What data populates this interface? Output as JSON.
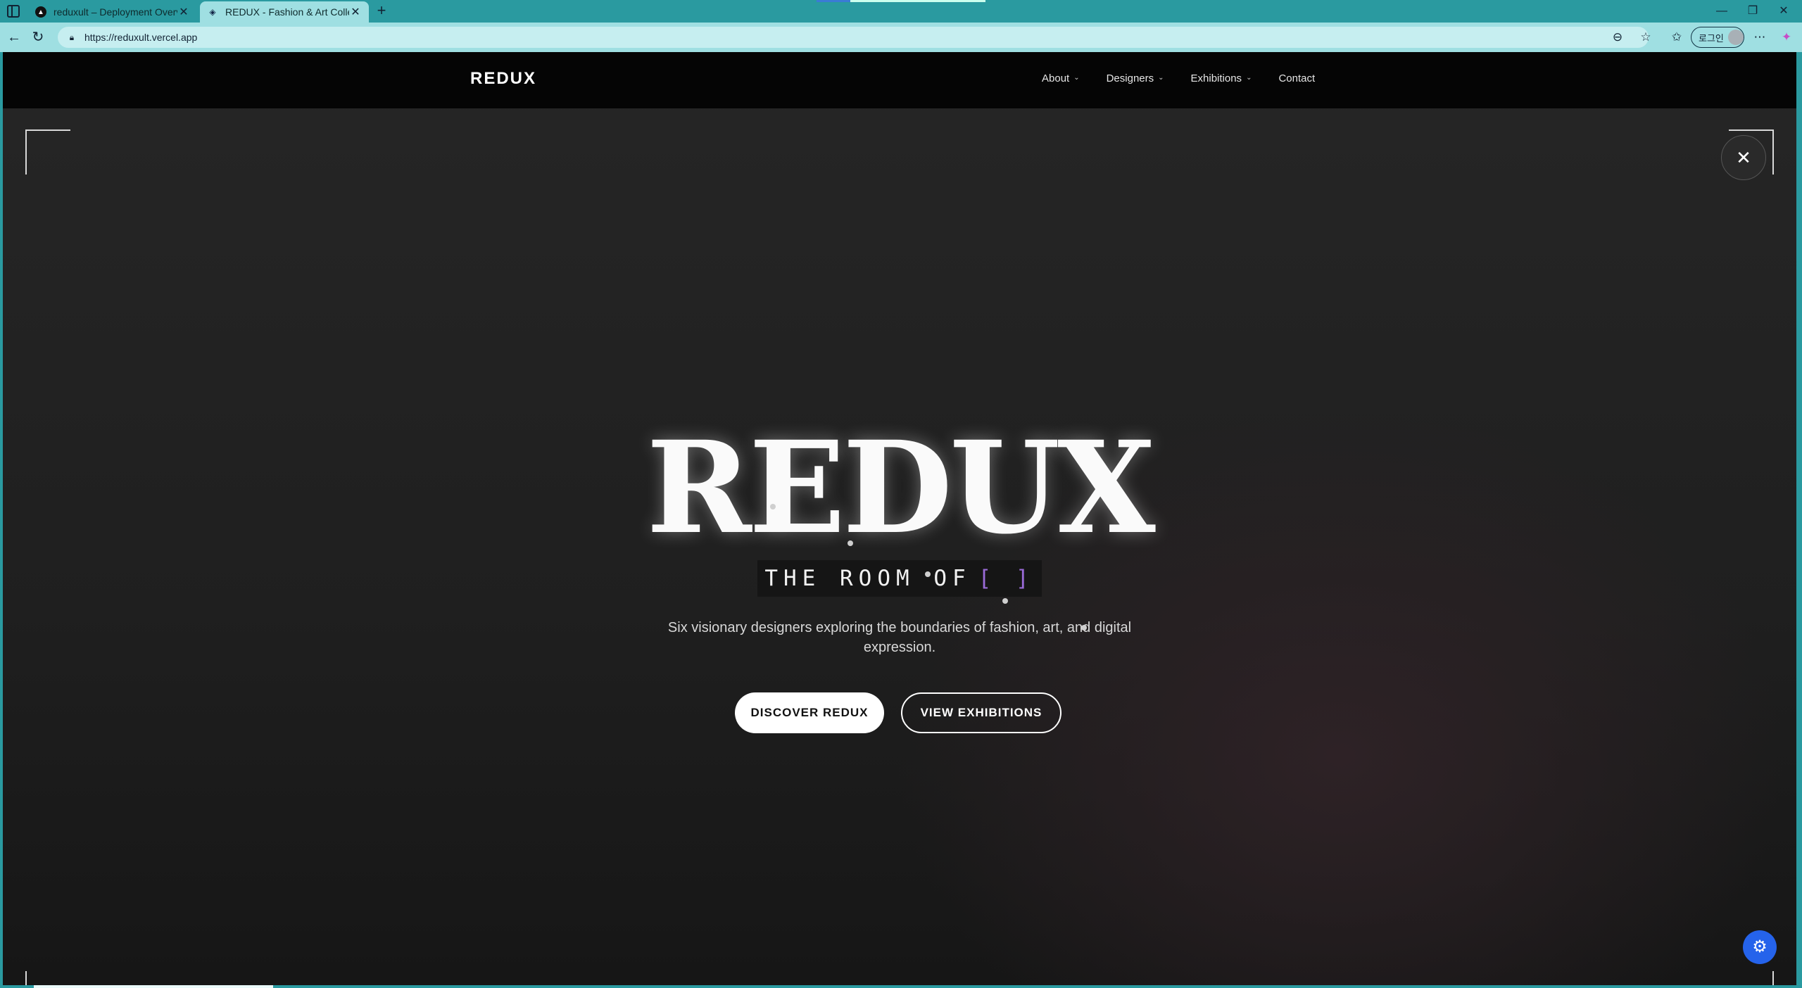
{
  "browser": {
    "tabs": [
      {
        "title": "reduxult – Deployment Overview",
        "active": false
      },
      {
        "title": "REDUX - Fashion & Art Collective",
        "active": true
      }
    ],
    "new_tab_symbol": "+",
    "url": "https://reduxult.vercel.app",
    "profile_label": "로그인",
    "window_controls": {
      "minimize": "—",
      "restore": "❐",
      "close": "✕"
    },
    "icons": [
      "sidebar-icon",
      "back-icon",
      "refresh-icon",
      "site-info-icon",
      "reader-icon",
      "star-icon",
      "favorites-icon",
      "more-icon",
      "copilot-icon"
    ]
  },
  "site": {
    "brand": "REDUX",
    "menu": [
      {
        "label": "About",
        "has_dropdown": true
      },
      {
        "label": "Designers",
        "has_dropdown": true
      },
      {
        "label": "Exhibitions",
        "has_dropdown": true
      },
      {
        "label": "Contact",
        "has_dropdown": false
      }
    ],
    "close_symbol": "✕"
  },
  "hero": {
    "title": "REDUX",
    "subtitle": "THE ROOM OF",
    "subtitle_bracket": "[ ]",
    "description": "Six visionary designers exploring the boundaries of fashion, art, and digital expression.",
    "primary_cta": "DISCOVER REDUX",
    "secondary_cta": "VIEW EXHIBITIONS"
  },
  "colors": {
    "accent_bracket": "#9a6bd8",
    "fab": "#2563eb",
    "browser_chrome": "#2a9aa0"
  }
}
